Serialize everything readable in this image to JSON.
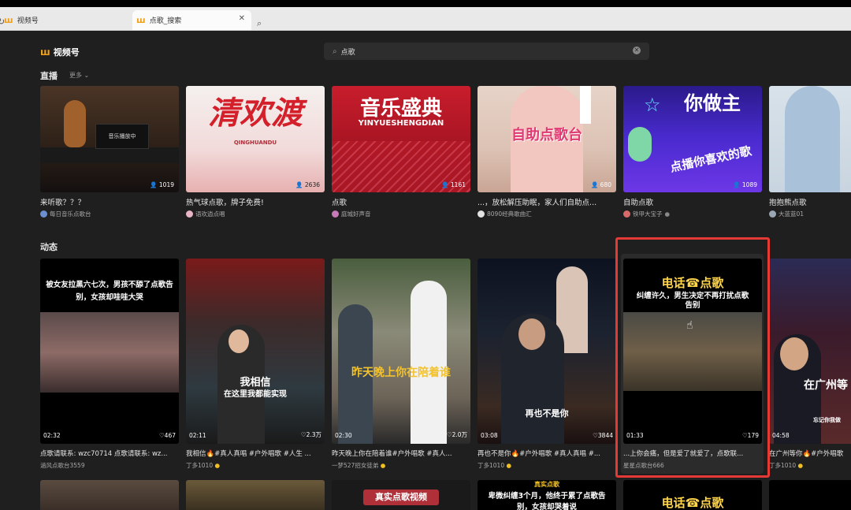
{
  "tabs": [
    {
      "label": "视频号"
    },
    {
      "label": "点歌_搜索"
    }
  ],
  "app": {
    "name": "视频号"
  },
  "search": {
    "value": "点歌"
  },
  "live": {
    "section_title": "直播",
    "more_label": "更多",
    "items": [
      {
        "title": "来听歌？？？",
        "author": "每日音乐点歌台",
        "viewers": "1019",
        "overlay": "音乐播放中"
      },
      {
        "title": "热气球点歌，牌子免费!",
        "author": "语欢逍点唱",
        "viewers": "2636",
        "overlay": "清欢渡",
        "overlay2": "QINGHUANDU"
      },
      {
        "title": "点歌",
        "author": "庭城好声音",
        "viewers": "1161",
        "overlay": "音乐盛典",
        "overlay2": "YINYUESHENGDIAN"
      },
      {
        "title": "...，放松解压助眠，家人们自助点...",
        "author": "8090经典歌曲汇",
        "viewers": "680",
        "overlay": "自助点歌台"
      },
      {
        "title": "自助点歌",
        "author": "铁甲大宝子",
        "viewers": "1089",
        "overlay": "你做主",
        "overlay2": "点播你喜欢的歌"
      },
      {
        "title": "抱抱熊点歌",
        "author": "大蓝蓝01"
      }
    ]
  },
  "feed": {
    "section_title": "动态",
    "items": [
      {
        "title": "点歌请联系: wzc70714 点歌请联系: wz...",
        "author": "涵风点歌台3559",
        "duration": "02:32",
        "likes": "467",
        "caption": "被女友拉黑六七次，男孩不舔了点歌告别，女孩却哇哇大哭"
      },
      {
        "title": "我相信🔥#真人真唱 #户外唱歌 #人生 ...",
        "author": "丁多1010",
        "duration": "02:11",
        "likes": "2.3万",
        "caption": "我相信",
        "caption2": "在这里我都能实现"
      },
      {
        "title": "昨天晚上你在陪着谁#户外唱歌 #真人...",
        "author": "一梦527招女徒弟",
        "duration": "02:30",
        "likes": "2.0万",
        "caption": "昨天晚上你在陪着谁"
      },
      {
        "title": "再也不是你🔥#户外唱歌 #真人真唱 #...",
        "author": "丁多1010",
        "duration": "03:08",
        "likes": "3844",
        "caption": "再也不是你"
      },
      {
        "title": "...上你会痛，但是爱了就爱了，点歌联...",
        "author": "星星点歌台666",
        "duration": "01:33",
        "likes": "179",
        "caption": "电话☎点歌",
        "caption2": "纠缠许久，男生决定不再打扰点歌告别"
      },
      {
        "title": "在广州等你🔥#户外唱歌",
        "author": "丁多1010",
        "duration": "04:58",
        "likes": "",
        "caption": "在广州等",
        "caption2": "忘记你我做"
      }
    ]
  },
  "row3": {
    "captions": [
      "",
      "",
      "真实点歌视频",
      "卑微纠缠3个月，他终于累了点歌告别，女孩却哭着说",
      "电话☎点歌",
      ""
    ],
    "top_caption": "真实点歌"
  },
  "colors": {
    "background": "#1f1f1f",
    "accent": "#f0a11c",
    "highlight": "#e53935"
  }
}
